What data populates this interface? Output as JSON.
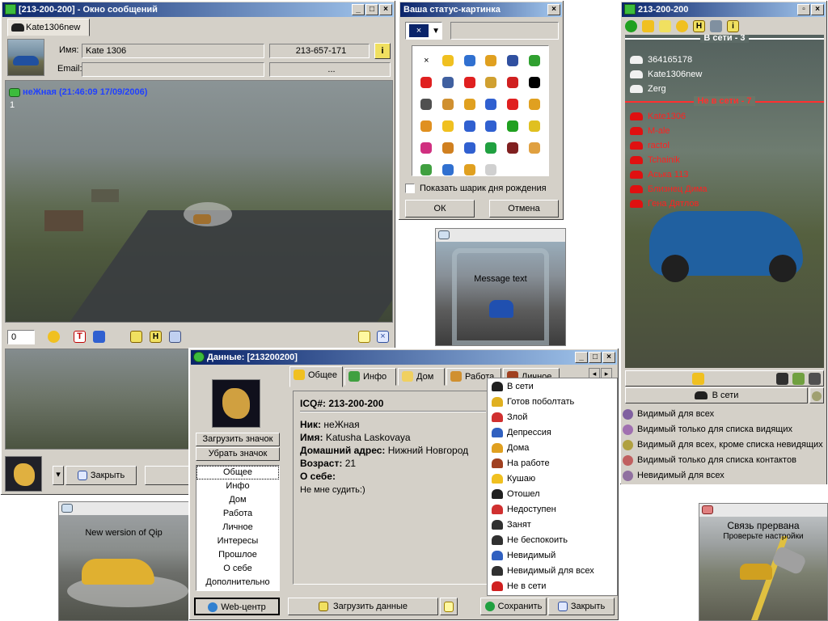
{
  "msg_window": {
    "title": "[213-200-200] - Окно сообщений",
    "tab_label": "Kate1306new",
    "name_label": "Имя:",
    "name_value": "Kate  1306",
    "phone_value": "213-657-171",
    "email_label": "Email:",
    "email_extra": "...",
    "history_header": "неЖная (21:46:09 17/09/2006)",
    "history_line": "1",
    "counter": "0",
    "close_label": "Закрыть"
  },
  "status_picker": {
    "title": "Ваша статус-картинка",
    "selected": "×",
    "birthday_label": "Показать шарик дня рождения",
    "ok_label": "ОК",
    "cancel_label": "Отмена",
    "icon_colors": [
      "#000000",
      "#f0c020",
      "#3070d0",
      "#e0a020",
      "#3050a0",
      "#30a030",
      "#e02020",
      "#4060a0",
      "#e02020",
      "#d0a030",
      "#d02020",
      "#000000",
      "#505050",
      "#d09030",
      "#e0a020",
      "#3060d0",
      "#e02020",
      "#e0a020",
      "#e09020",
      "#f0c020",
      "#3060d0",
      "#3060d0",
      "#20a020",
      "#e0c020",
      "#d03080",
      "#d08020",
      "#3060d0",
      "#20a040",
      "#802020",
      "#e0a040",
      "#40a040",
      "#3070d0",
      "#e0a020",
      "#d0d0d0"
    ]
  },
  "popup_message": {
    "text": "Message text"
  },
  "contact_list": {
    "title": "213-200-200",
    "online_header": "В сети - 3",
    "offline_header": "Не в сети - 7",
    "online": [
      "364165178",
      "Kate1306new",
      "Zerg"
    ],
    "offline": [
      "Kate1306",
      "M-ale",
      "ractol",
      "Tchainik",
      "Аська 113",
      "Близнец Дима",
      "Гена Дятлов"
    ],
    "status_button": "В сети"
  },
  "privacy_menu": {
    "items": [
      "Видимый для всех",
      "Видимый только для списка видящих",
      "Видимый для всех, кроме списка невидящих",
      "Видимый только для списка контактов",
      "Невидимый для всех"
    ],
    "colors": [
      "#8060a0",
      "#a070b0",
      "#b0a040",
      "#c06060",
      "#9070a0"
    ]
  },
  "popup_news": {
    "text": "New wersion of Qip"
  },
  "popup_disconnect": {
    "title": "Связь прервана",
    "subtitle": "Проверьте настройки"
  },
  "data_window": {
    "title": "Данные: [213200200]",
    "tabs": [
      "Общее",
      "Инфо",
      "Дом",
      "Работа",
      "Личное"
    ],
    "load_icon_label": "Загрузить значок",
    "remove_icon_label": "Убрать значок",
    "nav_items": [
      "Общее",
      "Инфо",
      "Дом",
      "Работа",
      "Личное",
      "Интересы",
      "Прошлое",
      "О себе",
      "Дополнительно"
    ],
    "icq_label": "ICQ#: 213-200-200",
    "nick_label": "Ник:",
    "nick_value": "неЖная",
    "name_label": "Имя:",
    "name_value": "Katusha Laskovaya",
    "address_label": "Домашний адрес:",
    "address_value": "Нижний Новгород",
    "age_label": "Возраст:",
    "age_value": "21",
    "about_label": "О себе:",
    "about_value": "Не мне судить:)",
    "web_label": "Web-центр",
    "load_data_label": "Загрузить данные",
    "save_label": "Сохранить",
    "close_label": "Закрыть"
  },
  "status_menu": {
    "items": [
      "В сети",
      "Готов поболтать",
      "Злой",
      "Депрессия",
      "Дома",
      "На работе",
      "Кушаю",
      "Отошел",
      "Недоступен",
      "Занят",
      "Не беспокоить",
      "Невидимый",
      "Невидимый для всех",
      "Не в сети"
    ],
    "colors": [
      "#202020",
      "#e0b020",
      "#d03030",
      "#3060c0",
      "#e0a020",
      "#a04020",
      "#f0c020",
      "#202020",
      "#d03030",
      "#303030",
      "#303030",
      "#3060c0",
      "#303030",
      "#d02020"
    ]
  }
}
